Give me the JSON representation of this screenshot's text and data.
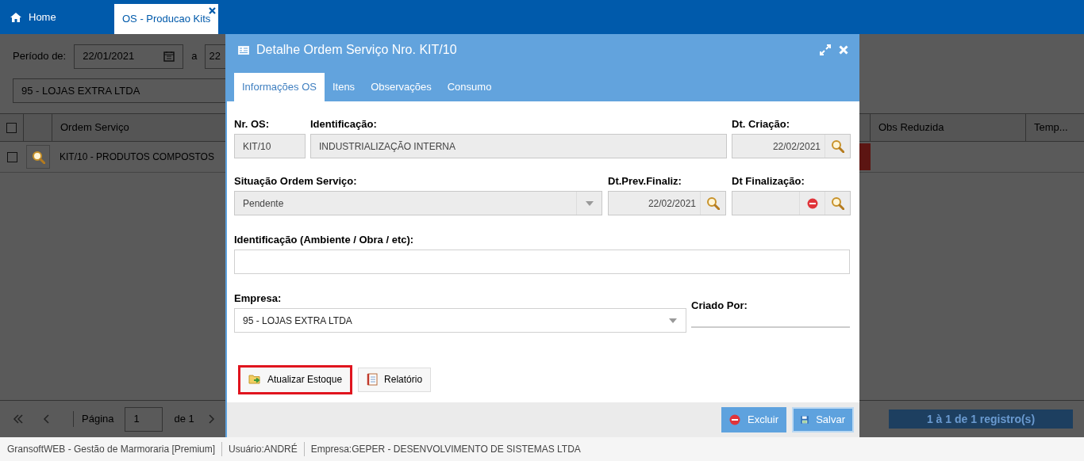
{
  "top_tabs": [
    {
      "label": "Home",
      "kind": "home",
      "selected": false
    },
    {
      "label": "OS - Producao Kits",
      "kind": "page",
      "selected": true
    }
  ],
  "filters": {
    "period_label": "Período de:",
    "date_from": "22/01/2021",
    "separator": "a",
    "date_to": "22",
    "company": "95 - LOJAS EXTRA LTDA"
  },
  "table": {
    "select_all_checked": false,
    "columns": [
      "Ordem Serviço",
      "Obs Reduzida",
      "Temp..."
    ],
    "rows": [
      {
        "checked": false,
        "ordem": "KIT/10 - PRODUTOS COMPOSTOS"
      }
    ]
  },
  "pager": {
    "page_label": "Página",
    "page": "1",
    "of": "de 1",
    "summary": "1 à 1 de 1 registro(s)"
  },
  "dialog": {
    "title": "Detalhe Ordem Serviço Nro. KIT/10",
    "tabs": [
      {
        "label": "Informações OS",
        "selected": true
      },
      {
        "label": "Itens",
        "selected": false
      },
      {
        "label": "Observações",
        "selected": false
      },
      {
        "label": "Consumo",
        "selected": false
      }
    ],
    "nr_os": {
      "label": "Nr. OS:",
      "value": "KIT/10",
      "readonly": true
    },
    "identificacao": {
      "label": "Identificação:",
      "value": "INDUSTRIALIZAÇÃO INTERNA",
      "readonly": true
    },
    "dt_criacao": {
      "label": "Dt. Criação:",
      "value": "22/02/2021",
      "readonly": true
    },
    "situacao": {
      "label": "Situação Ordem Serviço:",
      "value": "Pendente",
      "readonly": true
    },
    "dt_prev": {
      "label": "Dt.Prev.Finaliz:",
      "value": "22/02/2021",
      "readonly": true
    },
    "dt_finalizacao": {
      "label": "Dt Finalização:",
      "readonly": true
    },
    "ambiente": {
      "label": "Identificação (Ambiente / Obra / etc):",
      "readonly": false
    },
    "empresa": {
      "label": "Empresa:",
      "value": "95 - LOJAS EXTRA LTDA",
      "readonly": false
    },
    "criado_por": {
      "label": "Criado Por:"
    },
    "actions": [
      {
        "label": "Atualizar Estoque",
        "kind": "stock",
        "highlighted": true
      },
      {
        "label": "Relatório",
        "kind": "report",
        "highlighted": false
      }
    ],
    "footer_buttons": [
      {
        "label": "Excluir",
        "kind": "delete"
      },
      {
        "label": "Salvar",
        "kind": "save"
      }
    ]
  },
  "status_bar": [
    "GransoftWEB - Gestão de Marmoraria [Premium]",
    "Usuário:ANDRÉ",
    "Empresa:GEPER - DESENVOLVIMENTO DE SISTEMAS LTDA"
  ]
}
